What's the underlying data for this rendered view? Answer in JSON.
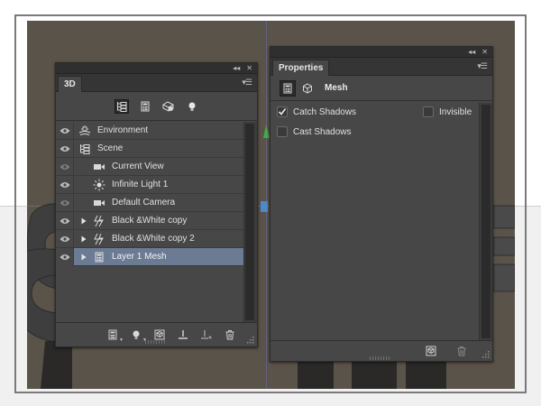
{
  "panel3d": {
    "tab_label": "3D",
    "menu_icon": "panel-menu-icon",
    "collapse_icon": "collapse-double-arrow-icon",
    "close_icon": "close-icon",
    "filters": [
      {
        "name": "filter-scene-icon",
        "active": true
      },
      {
        "name": "filter-mesh-icon",
        "active": false
      },
      {
        "name": "filter-materials-icon",
        "active": false
      },
      {
        "name": "filter-lights-icon",
        "active": false
      }
    ],
    "layers": [
      {
        "label": "Environment",
        "icon": "environment-icon",
        "eye_visible": true,
        "expandable": false,
        "indent": 0
      },
      {
        "label": "Scene",
        "icon": "scene-icon",
        "eye_visible": true,
        "expandable": false,
        "indent": 0
      },
      {
        "label": "Current View",
        "icon": "camera-icon",
        "eye_visible": false,
        "expandable": false,
        "indent": 1
      },
      {
        "label": "Infinite Light 1",
        "icon": "light-icon",
        "eye_visible": true,
        "expandable": false,
        "indent": 1
      },
      {
        "label": "Default Camera",
        "icon": "camera-icon",
        "eye_visible": false,
        "expandable": false,
        "indent": 1
      },
      {
        "label": "Black &White copy",
        "icon": "mesh-icon",
        "eye_visible": true,
        "expandable": true,
        "indent": 1
      },
      {
        "label": "Black &White copy 2",
        "icon": "mesh-icon",
        "eye_visible": true,
        "expandable": true,
        "indent": 1
      },
      {
        "label": "Layer 1 Mesh",
        "icon": "mesh-layer-icon",
        "eye_visible": true,
        "expandable": true,
        "indent": 1,
        "selected": true
      }
    ],
    "footer_buttons": [
      "mesh-add-icon",
      "light-add-icon",
      "material-add-icon",
      "drop-to-ground-icon",
      "render-icon",
      "trash-icon"
    ]
  },
  "properties": {
    "tab_label": "Properties",
    "section_title": "Mesh",
    "options": [
      {
        "label": "Catch Shadows",
        "checked": true
      },
      {
        "label": "Invisible",
        "checked": false
      },
      {
        "label": "Cast Shadows",
        "checked": false
      }
    ],
    "footer_buttons": [
      "reset-3d-icon",
      "trash-icon"
    ]
  },
  "colors": {
    "panel_bg": "#474747",
    "selected_row": "#6c7b94",
    "canvas_bg": "#5a5349"
  }
}
